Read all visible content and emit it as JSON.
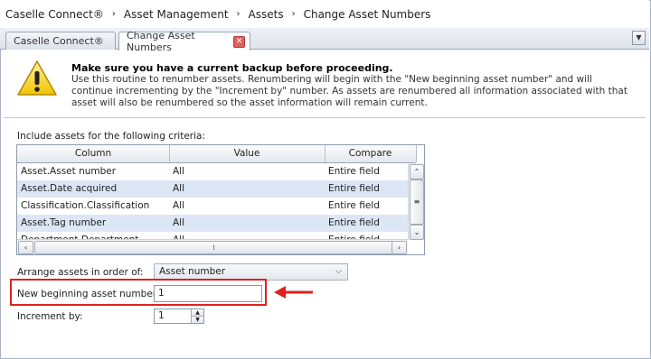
{
  "breadcrumb": {
    "items": [
      "Caselle Connect®",
      "Asset Management",
      "Assets",
      "Change Asset Numbers"
    ],
    "separator": "›"
  },
  "tabs": {
    "items": [
      {
        "label": "Caselle Connect®"
      },
      {
        "label": "Change Asset Numbers"
      }
    ],
    "close_glyph": "✕",
    "dropdown_glyph": "▼"
  },
  "warning": {
    "icon": "warning-triangle-icon",
    "title": "Make sure you have a current backup before proceeding.",
    "text": "Use this routine to renumber assets. Renumbering will begin with the \"New beginning asset number\" and will continue incrementing by the \"Increment by\" number. As assets are renumbered all information associated with that asset will also be renumbered so the asset information will remain current."
  },
  "criteria": {
    "label": "Include assets for the following criteria:",
    "columns": [
      "Column",
      "Value",
      "Compare"
    ],
    "rows": [
      {
        "column": "Asset.Asset number",
        "value": "All",
        "compare": "Entire field"
      },
      {
        "column": "Asset.Date acquired",
        "value": "All",
        "compare": "Entire field"
      },
      {
        "column": "Classification.Classification",
        "value": "All",
        "compare": "Entire field"
      },
      {
        "column": "Asset.Tag number",
        "value": "All",
        "compare": "Entire field"
      },
      {
        "column": "Department.Department",
        "value": "All",
        "compare": "Entire field"
      }
    ]
  },
  "form": {
    "order_label": "Arrange assets in order of:",
    "order_value": "Asset number",
    "begin_label": "New beginning asset number:",
    "begin_value": "1",
    "increment_label": "Increment by:",
    "increment_value": "1"
  },
  "colors": {
    "highlight_box": "#e02020",
    "row_alt": "#dce6f5",
    "warning_yellow": "#f6d21a"
  }
}
